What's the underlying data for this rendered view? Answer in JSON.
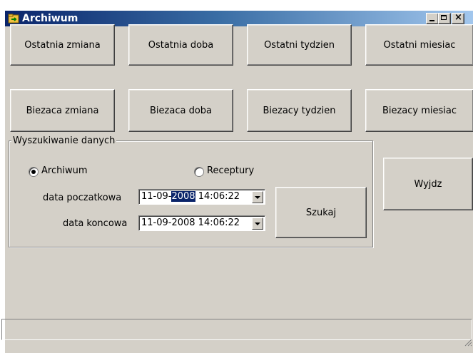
{
  "window": {
    "title": "Archiwum"
  },
  "buttons_row1": [
    "Ostatnia zmiana",
    "Ostatnia doba",
    "Ostatni tydzien",
    "Ostatni miesiac"
  ],
  "buttons_row2": [
    "Biezaca zmiana",
    "Biezaca doba",
    "Biezacy tydzien",
    "Biezacy miesiac"
  ],
  "search": {
    "group_label": "Wyszukiwanie danych",
    "radio_archive": "Archiwum",
    "radio_recipes": "Receptury",
    "selected_radio": "Archiwum",
    "start_label": "data poczatkowa",
    "start_prefix": "11-09-",
    "start_selected": "2008",
    "start_suffix": " 14:06:22",
    "end_label": "data koncowa",
    "end_value": "11-09-2008 14:06:22",
    "search_button": "Szukaj"
  },
  "exit_button": "Wyjdz",
  "colors": {
    "titlebar": "#0a246a",
    "face": "#d4d0c8",
    "selection": "#0a246a"
  },
  "icons": [
    "app-icon",
    "minimize-icon",
    "maximize-icon",
    "close-icon",
    "dropdown-arrow-icon",
    "resize-grip-icon"
  ]
}
